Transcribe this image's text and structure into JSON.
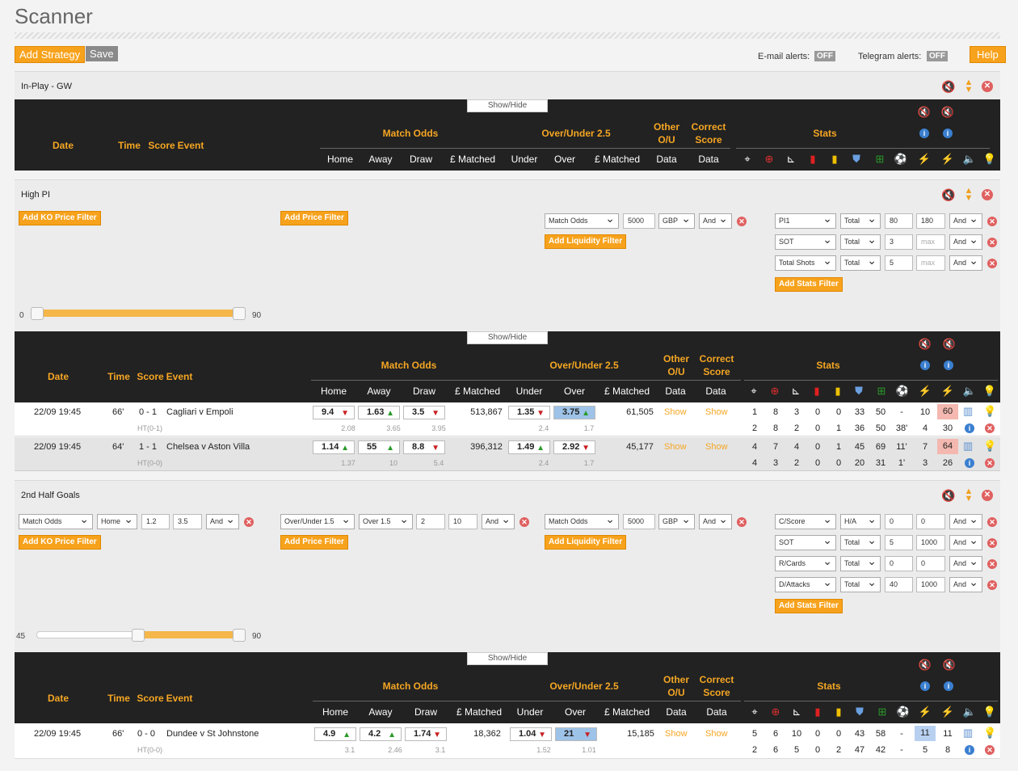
{
  "page": {
    "title": "Scanner",
    "add_strategy": "Add Strategy",
    "save": "Save",
    "help": "Help",
    "email_label": "E-mail alerts:",
    "email_state": "OFF",
    "telegram_label": "Telegram alerts:",
    "telegram_state": "OFF"
  },
  "headers": {
    "date": "Date",
    "time": "Time",
    "score": "Score",
    "event": "Event",
    "match_odds": "Match Odds",
    "ou": "Over/Under 2.5",
    "other_ou_1": "Other",
    "other_ou_2": "O/U",
    "correct_1": "Correct",
    "correct_2": "Score",
    "stats": "Stats",
    "home": "Home",
    "away": "Away",
    "draw": "Draw",
    "matched": "£ Matched",
    "under": "Under",
    "over": "Over",
    "data": "Data",
    "showhide": "Show/Hide"
  },
  "strategies": [
    {
      "name": "In-Play - GW"
    },
    {
      "name": "High PI",
      "add_ko": "Add KO Price Filter",
      "add_price": "Add Price Filter",
      "add_liq": "Add Liquidity Filter",
      "add_stats": "Add Stats Filter",
      "liq": {
        "market": "Match Odds",
        "amount": "5000",
        "currency": "GBP",
        "logic": "And"
      },
      "stats_filters": [
        {
          "stat": "PI1",
          "scope": "Total",
          "min": "80",
          "max": "180",
          "logic": "And"
        },
        {
          "stat": "SOT",
          "scope": "Total",
          "min": "3",
          "max": "max",
          "logic": "And"
        },
        {
          "stat": "Total Shots",
          "scope": "Total",
          "min": "5",
          "max": "max",
          "logic": "And"
        }
      ],
      "slider": {
        "min": "0",
        "max": "90",
        "low": 0,
        "high": 90
      },
      "rows": [
        {
          "date": "22/09 19:45",
          "time": "66'",
          "score": "0 - 1",
          "event": "Cagliari v Empoli",
          "ht": "HT(0-1)",
          "home": "9.4",
          "away": "1.63",
          "draw": "3.5",
          "matched": "513,867",
          "under": "1.35",
          "over": "3.75",
          "ou_matched": "61,505",
          "show1": "Show",
          "show2": "Show",
          "ko_home": "2.08",
          "ko_away": "3.65",
          "ko_draw": "3.95",
          "ko_under": "2.4",
          "ko_over": "1.7",
          "s1": [
            "1",
            "8",
            "3",
            "0",
            "0",
            "33",
            "50",
            "-",
            "10",
            "60"
          ],
          "s2": [
            "2",
            "8",
            "2",
            "0",
            "1",
            "36",
            "50",
            "38'",
            "4",
            "30"
          ]
        },
        {
          "date": "22/09 19:45",
          "time": "64'",
          "score": "1 - 1",
          "event": "Chelsea v Aston Villa",
          "ht": "HT(0-0)",
          "home": "1.14",
          "away": "55",
          "draw": "8.8",
          "matched": "396,312",
          "under": "1.49",
          "over": "2.92",
          "ou_matched": "45,177",
          "show1": "Show",
          "show2": "Show",
          "ko_home": "1.37",
          "ko_away": "10",
          "ko_draw": "5.4",
          "ko_under": "2.4",
          "ko_over": "1.7",
          "s1": [
            "4",
            "7",
            "4",
            "0",
            "1",
            "45",
            "69",
            "11'",
            "7",
            "64"
          ],
          "s2": [
            "4",
            "3",
            "2",
            "0",
            "0",
            "20",
            "31",
            "1'",
            "3",
            "26"
          ]
        }
      ]
    },
    {
      "name": "2nd Half Goals",
      "add_ko": "Add KO Price Filter",
      "add_price": "Add Price Filter",
      "add_liq": "Add Liquidity Filter",
      "add_stats": "Add Stats Filter",
      "ko": {
        "market": "Match Odds",
        "side": "Home",
        "min": "1.2",
        "max": "3.5",
        "logic": "And"
      },
      "price": {
        "market": "Over/Under 1.5",
        "side": "Over 1.5",
        "min": "2",
        "max": "10",
        "logic": "And"
      },
      "liq": {
        "market": "Match Odds",
        "amount": "5000",
        "currency": "GBP",
        "logic": "And"
      },
      "stats_filters": [
        {
          "stat": "C/Score",
          "scope": "H/A",
          "min": "0",
          "max": "0",
          "logic": "And"
        },
        {
          "stat": "SOT",
          "scope": "Total",
          "min": "5",
          "max": "1000",
          "logic": "And"
        },
        {
          "stat": "R/Cards",
          "scope": "Total",
          "min": "0",
          "max": "0",
          "logic": "And"
        },
        {
          "stat": "D/Attacks",
          "scope": "Total",
          "min": "40",
          "max": "1000",
          "logic": "And"
        }
      ],
      "slider": {
        "min": "45",
        "max": "90",
        "low": 45,
        "high": 90
      },
      "rows": [
        {
          "date": "22/09 19:45",
          "time": "66'",
          "score": "0 - 0",
          "event": "Dundee v St Johnstone",
          "ht": "HT(0-0)",
          "home": "4.9",
          "away": "4.2",
          "draw": "1.74",
          "matched": "18,362",
          "under": "1.04",
          "over": "21",
          "ou_matched": "15,185",
          "show1": "Show",
          "show2": "Show",
          "ko_home": "3.1",
          "ko_away": "2.46",
          "ko_draw": "3.1",
          "ko_under": "1.52",
          "ko_over": "1.01",
          "s1": [
            "5",
            "6",
            "10",
            "0",
            "0",
            "43",
            "58",
            "-",
            "11",
            "11"
          ],
          "s2": [
            "2",
            "6",
            "5",
            "0",
            "2",
            "47",
            "42",
            "-",
            "5",
            "8"
          ]
        }
      ]
    }
  ],
  "colors": {
    "accent": "#f7a21c",
    "header_bg": "#222222",
    "up": "#2a9a2a",
    "down": "#c82020"
  }
}
